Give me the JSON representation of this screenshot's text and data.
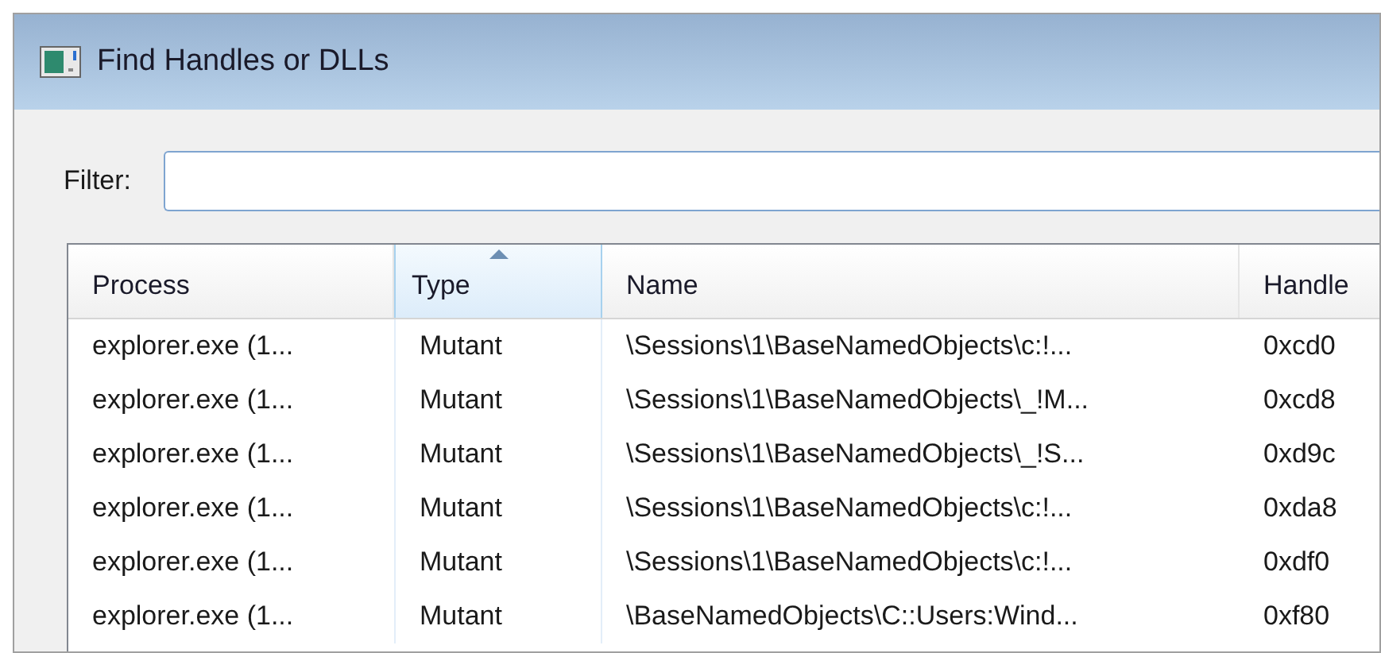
{
  "window": {
    "title": "Find Handles or DLLs"
  },
  "filter": {
    "label": "Filter:"
  },
  "table": {
    "columns": [
      {
        "label": "Process",
        "sorted": false
      },
      {
        "label": "Type",
        "sorted": true
      },
      {
        "label": "Name",
        "sorted": false
      },
      {
        "label": "Handle",
        "sorted": false
      }
    ],
    "rows": [
      [
        "explorer.exe (1...",
        "Mutant",
        "\\Sessions\\1\\BaseNamedObjects\\c:!...",
        "0xcd0"
      ],
      [
        "explorer.exe (1...",
        "Mutant",
        "\\Sessions\\1\\BaseNamedObjects\\_!M...",
        "0xcd8"
      ],
      [
        "explorer.exe (1...",
        "Mutant",
        "\\Sessions\\1\\BaseNamedObjects\\_!S...",
        "0xd9c"
      ],
      [
        "explorer.exe (1...",
        "Mutant",
        "\\Sessions\\1\\BaseNamedObjects\\c:!...",
        "0xda8"
      ],
      [
        "explorer.exe (1...",
        "Mutant",
        "\\Sessions\\1\\BaseNamedObjects\\c:!...",
        "0xdf0"
      ],
      [
        "explorer.exe (1...",
        "Mutant",
        "\\BaseNamedObjects\\C::Users:Wind...",
        "0xf80"
      ]
    ]
  }
}
